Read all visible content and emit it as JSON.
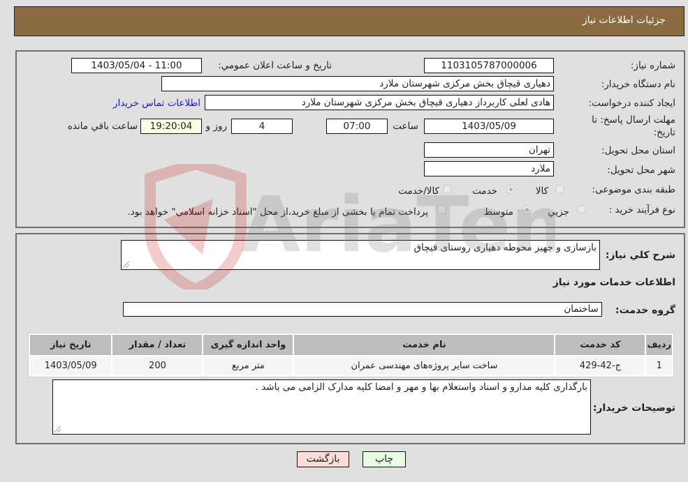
{
  "header": {
    "title": "جزئیات اطلاعات نیاز"
  },
  "form": {
    "need_number": {
      "label": "شماره نیاز:",
      "value": "1103105787000006"
    },
    "announce_datetime": {
      "label": "تاریخ و ساعت اعلان عمومي:",
      "value": "1403/05/04 - 11:00"
    },
    "buyer_org": {
      "label": "نام دستگاه خریدار:",
      "value": "دهیاری قیچاق بخش مرکزی شهرستان ملارد"
    },
    "requester": {
      "label": "ایجاد کننده درخواست:",
      "value": "هادی لعلی کاربرداز دهیاری قیچاق بخش مرکزی شهرستان ملارد",
      "contact_link": "اطلاعات تماس خریدار"
    },
    "deadline": {
      "label_line1": "مهلت ارسال پاسخ: تا",
      "label_line2": "تاریخ:",
      "date": "1403/05/09",
      "time_label": "ساعت",
      "time": "07:00",
      "days": "4",
      "days_label": "روز و",
      "remaining": "19:20:04",
      "remaining_label": "ساعت باقي مانده"
    },
    "province": {
      "label": "استان محل تحویل:",
      "value": "تهران"
    },
    "city": {
      "label": "شهر محل تحویل:",
      "value": "ملارد"
    },
    "category": {
      "label": "طبقه بندی موضوعی:",
      "options": [
        "کالا",
        "خدمت",
        "کالا/خدمت"
      ],
      "selected": "خدمت"
    },
    "purchase_type": {
      "label": "نوع فرآیند خرید :",
      "options": [
        "جزيي",
        "متوسط"
      ],
      "selected": "متوسط",
      "treasury_note": "پرداخت تمام یا بخشی از مبلغ خرید،از محل \"اسناد خزانه اسلامی\" خواهد بود."
    }
  },
  "details": {
    "general_desc_label": "شرح کلي نیاز:",
    "general_desc": "بازسازی و جهیز محوطه دهیاری روستای قیچاق",
    "services_title": "اطلاعات خدمات مورد نیاز",
    "service_group_label": "گروه خدمت:",
    "service_group": "ساختمان",
    "table": {
      "headers": [
        "رديف",
        "کد خدمت",
        "نام خدمت",
        "واحد اندازه گیری",
        "تعداد / مقدار",
        "تاریخ نیاز"
      ],
      "rows": [
        [
          "1",
          "ج-42-429",
          "ساخت سایر پروژه‌های مهندسی عمران",
          "متر مربع",
          "200",
          "1403/05/09"
        ]
      ]
    },
    "buyer_notes_label": "توضیحات خریدار:",
    "buyer_notes": "بارگذاری کلیه مدارو و اسناد واستعلام بها و مهر و امضا کلیه مدارک الزامی می باشد ."
  },
  "buttons": {
    "print": "چاپ",
    "back": "بازگشت"
  },
  "watermark": {
    "text": "AriaTender.neT"
  }
}
